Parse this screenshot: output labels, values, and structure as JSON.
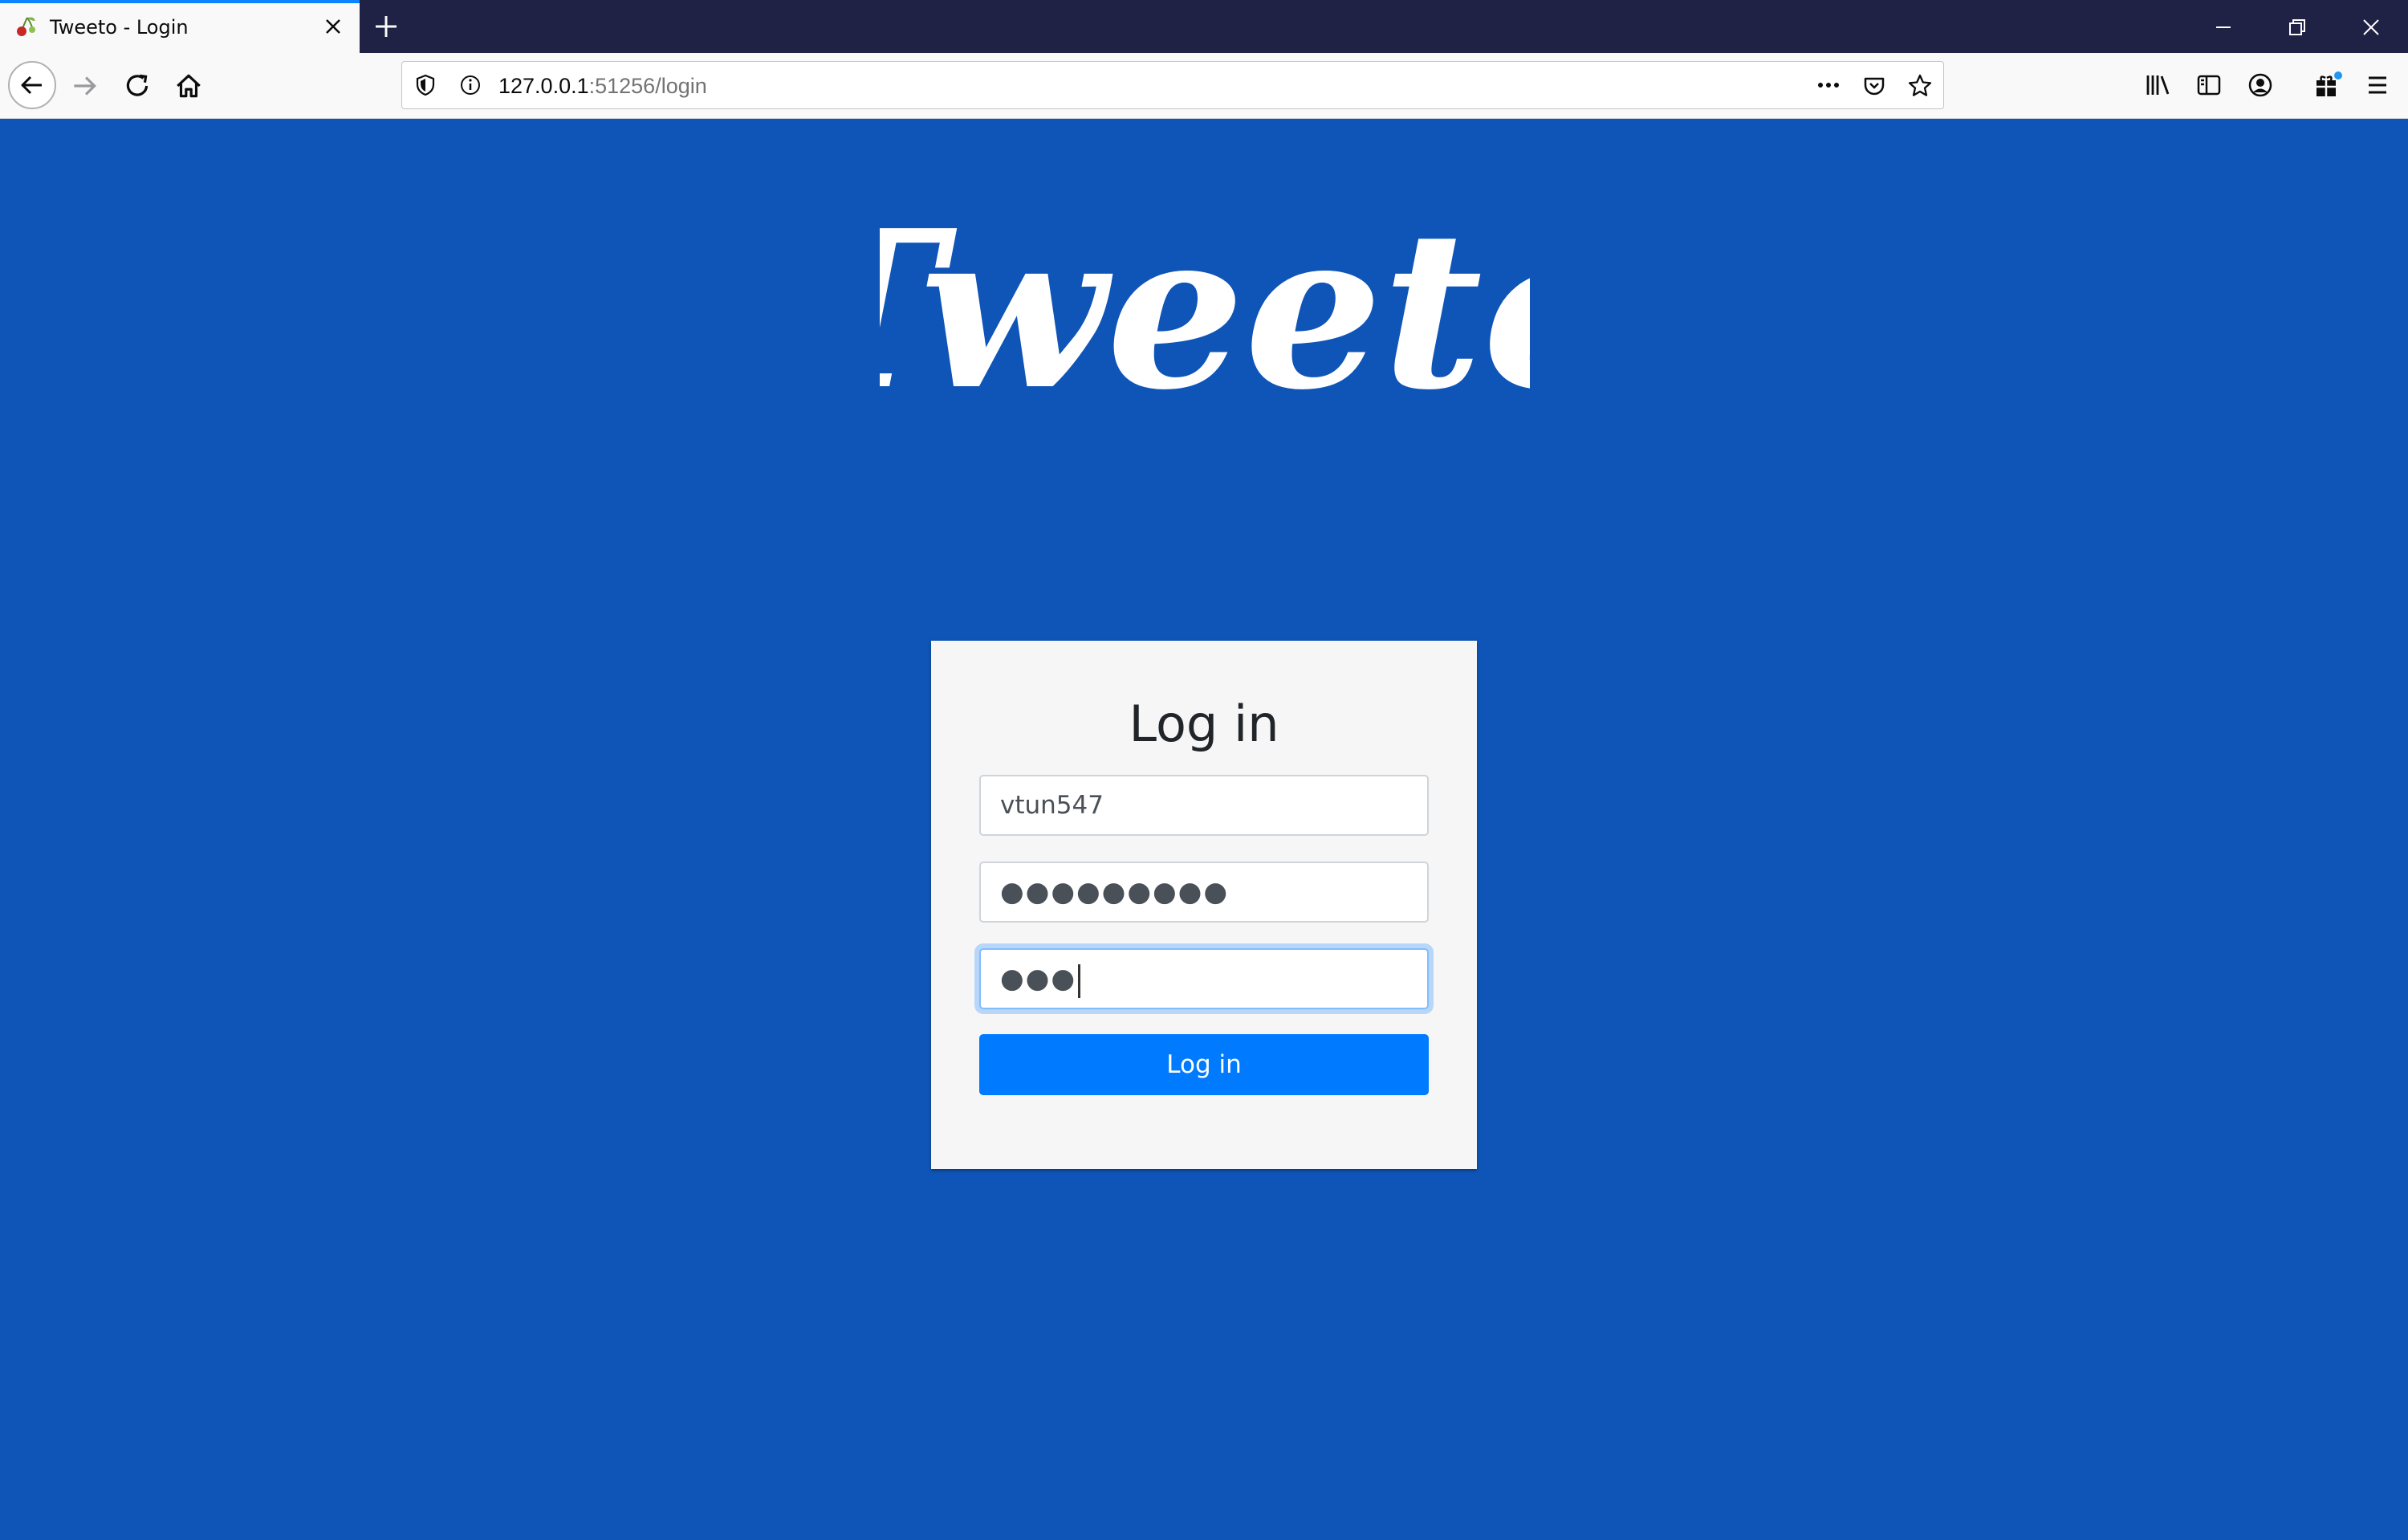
{
  "browser": {
    "tab": {
      "title": "Tweeto - Login",
      "favicon": "cherry-icon"
    },
    "url": {
      "host": "127.0.0.1",
      "rest": ":51256/login"
    },
    "accent_color": "#0a84ff"
  },
  "page": {
    "background_color": "#0f55b8",
    "logo_text": "Tweeto",
    "form": {
      "title": "Log in",
      "username_value": "vtun547",
      "password_value": "●●●●●●●●●",
      "confirm_value": "●●●",
      "submit_label": "Log in",
      "button_color": "#007bff"
    }
  }
}
